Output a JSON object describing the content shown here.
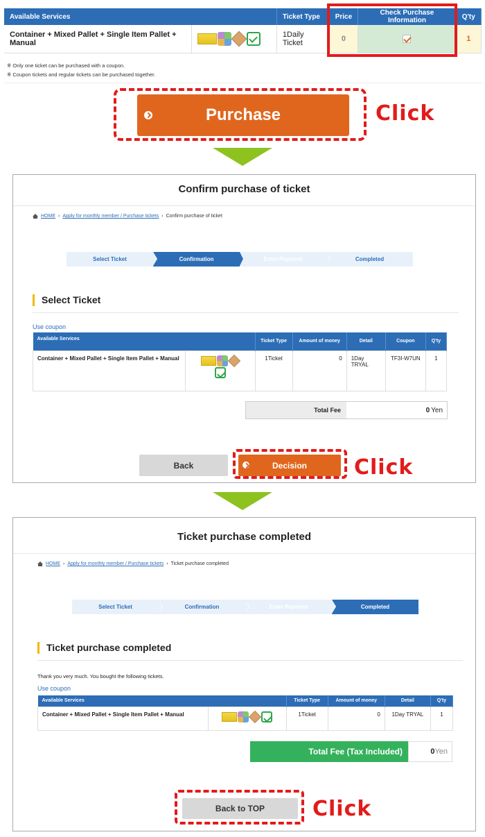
{
  "top_table": {
    "headers": {
      "services": "Available Services",
      "ticket_type": "Ticket Type",
      "price": "Price",
      "check": "Check Purchase Information",
      "qty": "Q'ty"
    },
    "row": {
      "service": "Container + Mixed Pallet + Single Item Pallet + Manual",
      "ticket_type": "1Daily Ticket",
      "price": "0",
      "qty": "1"
    },
    "notes": [
      "※ Only one ticket can be purchased with a coupon.",
      "※ Coupon tickets and regular tickets can be purchased together."
    ]
  },
  "purchase_button": "Purchase",
  "click_label": "Click",
  "confirm_panel": {
    "title": "Confirm purchase of ticket",
    "breadcrumb": {
      "home": "HOME",
      "parent": "Apply for monthly member / Purchase tickets",
      "current": "Confirm purchase of ticket"
    },
    "steps": [
      "Select Ticket",
      "Confirmation",
      "Enter Payment",
      "Completed"
    ],
    "heading": "Select Ticket",
    "coupon_link": "Use coupon",
    "headers": {
      "services": "Available Services",
      "ticket_type": "Ticket Type",
      "amount": "Amount of money",
      "detail": "Detail",
      "coupon": "Coupon",
      "qty": "Q'ty"
    },
    "row": {
      "service": "Container + Mixed Pallet + Single Item Pallet + Manual",
      "ticket_type": "1Ticket",
      "amount": "0",
      "detail": "1Day TRYAL",
      "coupon": "TF3I-W7UN",
      "qty": "1"
    },
    "total_label": "Total Fee",
    "total_value": "0",
    "total_unit": "Yen",
    "back_button": "Back",
    "decision_button": "Decision"
  },
  "complete_panel": {
    "title": "Ticket purchase completed",
    "breadcrumb": {
      "home": "HOME",
      "parent": "Apply for monthly member / Purchase tickets",
      "current": "Ticket purchase completed"
    },
    "steps": [
      "Select Ticket",
      "Confirmation",
      "Enter Payment",
      "Completed"
    ],
    "heading": "Ticket purchase completed",
    "thanks": "Thank you very much. You bought the following tickets.",
    "coupon_link": "Use coupon",
    "headers": {
      "services": "Available Services",
      "ticket_type": "Ticket Type",
      "amount": "Amount of money",
      "detail": "Detail",
      "qty": "Q'ty"
    },
    "row": {
      "service": "Container + Mixed Pallet + Single Item Pallet + Manual",
      "ticket_type": "1Ticket",
      "amount": "0",
      "detail": "1Day TRYAL",
      "qty": "1"
    },
    "total_label": "Total Fee (Tax Included)",
    "total_value": "0",
    "total_unit": "Yen",
    "top_button": "Back to TOP"
  },
  "colors": {
    "primary": "#2c6db6",
    "accent": "#e0661d",
    "highlight": "#e21b1b",
    "success": "#34b15c",
    "arrow": "#8dc21f"
  },
  "icons": [
    "container-pallet-icon",
    "mixed-pallet-icon",
    "single-item-pallet-icon",
    "manual-icon",
    "home-icon",
    "chevron-circle-icon",
    "checkbox-icon"
  ]
}
